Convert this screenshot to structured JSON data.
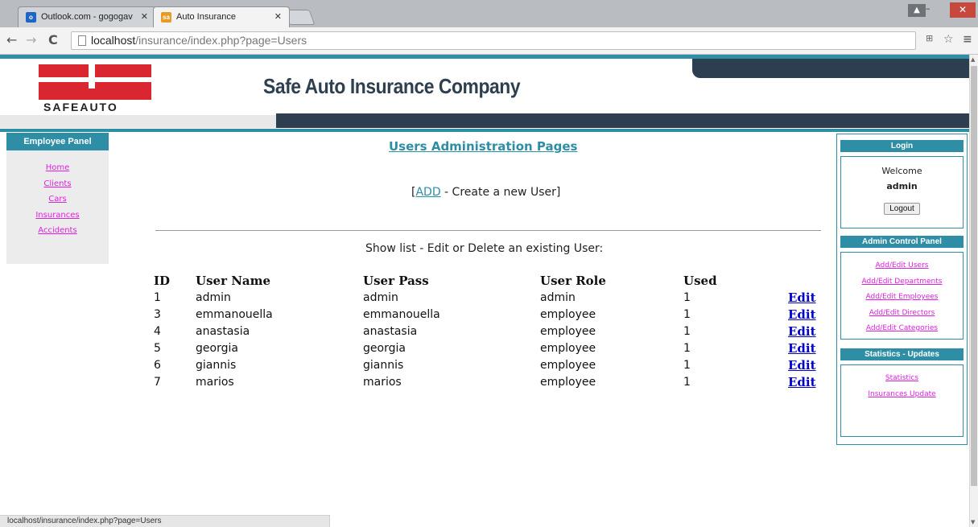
{
  "browser": {
    "tabs": [
      {
        "title": "Outlook.com - gogogav",
        "icon": "outlook-icon"
      },
      {
        "title": "Auto Insurance",
        "icon": "insurance-favicon"
      }
    ],
    "url_host": "localhost",
    "url_path": "/insurance/index.php?page=Users",
    "status_url": "localhost/insurance/index.php?page=Users"
  },
  "header": {
    "logo_text": "SAFEAUTO",
    "title": "Safe Auto Insurance Company"
  },
  "left_panel": {
    "title": "Employee Panel",
    "links": [
      "Home",
      "Clients",
      "Cars",
      "Insurances",
      "Accidents"
    ]
  },
  "main": {
    "title": "Users Administration Pages",
    "add_prefix": "[",
    "add_link": "ADD",
    "add_suffix": " - Create a new User]",
    "list_caption": "Show list - Edit or Delete an existing User:",
    "columns": [
      "ID",
      "User Name",
      "User Pass",
      "User Role",
      "Used"
    ],
    "edit_label": "Edit",
    "rows": [
      {
        "id": "1",
        "name": "admin",
        "pass": "admin",
        "role": "admin",
        "used": "1"
      },
      {
        "id": "3",
        "name": "emmanouella",
        "pass": "emmanouella",
        "role": "employee",
        "used": "1"
      },
      {
        "id": "4",
        "name": "anastasia",
        "pass": "anastasia",
        "role": "employee",
        "used": "1"
      },
      {
        "id": "5",
        "name": "georgia",
        "pass": "georgia",
        "role": "employee",
        "used": "1"
      },
      {
        "id": "6",
        "name": "giannis",
        "pass": "giannis",
        "role": "employee",
        "used": "1"
      },
      {
        "id": "7",
        "name": "marios",
        "pass": "marios",
        "role": "employee",
        "used": "1"
      }
    ]
  },
  "right_panel": {
    "login_title": "Login",
    "welcome": "Welcome",
    "username": "admin",
    "logout_label": "Logout",
    "admin_title": "Admin Control Panel",
    "admin_links": [
      "Add/Edit Users",
      "Add/Edit Departments",
      "Add/Edit Employees",
      "Add/Edit Directors",
      "Add/Edit Categories"
    ],
    "stats_title": "Statistics - Updates",
    "stats_links": [
      "Statistics",
      "Insurances Update"
    ]
  },
  "colors": {
    "teal": "#2e8ea5",
    "dark_navy": "#2c3e4f",
    "link_magenta": "#e020e0",
    "logo_red": "#d92631"
  }
}
